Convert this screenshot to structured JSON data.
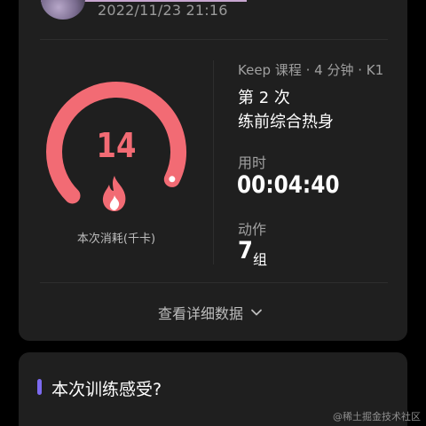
{
  "header": {
    "timestamp": "2022/11/23 21:16"
  },
  "summary": {
    "calories_value": "14",
    "calories_label": "本次消耗(千卡)",
    "calories_ring_fraction": 0.93,
    "accent_color": "#f26b74",
    "course_meta": "Keep 课程 · 4 分钟 · K1",
    "course_count": "第 2 次",
    "course_name": "练前综合热身",
    "duration_label": "用时",
    "duration_value": "00:04:40",
    "moves_label": "动作",
    "moves_value": "7",
    "moves_unit": "组"
  },
  "details_link": {
    "label": "查看详细数据"
  },
  "feeling": {
    "title": "本次训练感受?",
    "accent_color": "#7c6af0"
  },
  "watermark": "@稀土掘金技术社区"
}
